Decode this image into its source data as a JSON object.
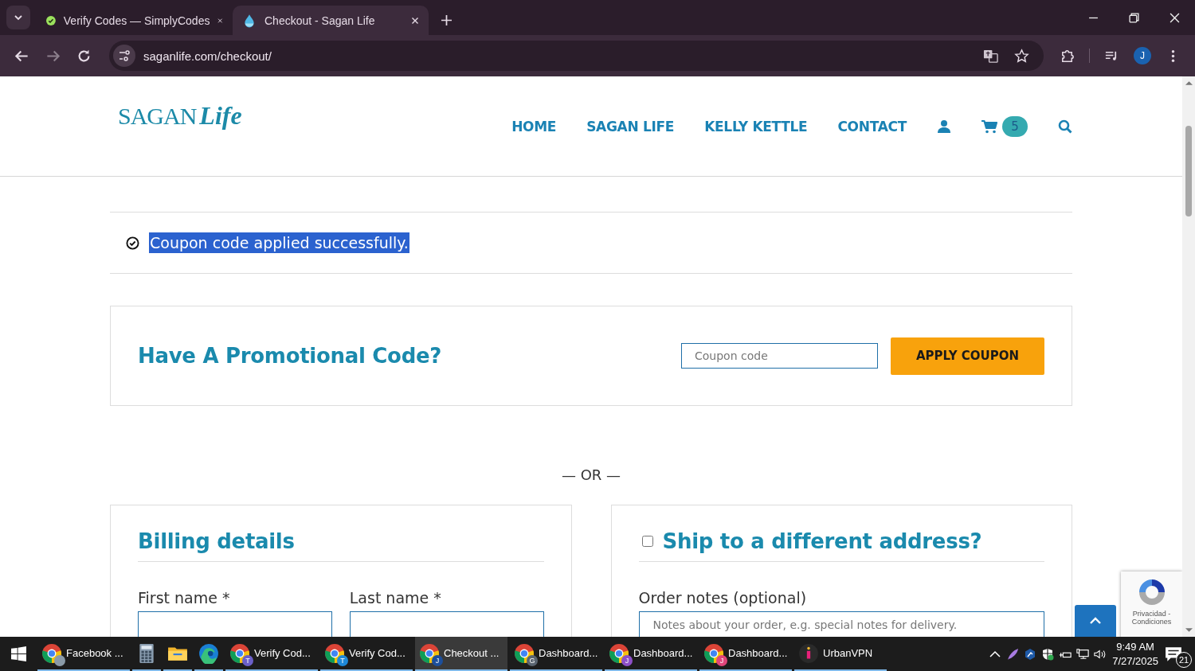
{
  "browser": {
    "tabs": [
      {
        "title": "Verify Codes — SimplyCodes",
        "kind": "simplycodes",
        "selected": false
      },
      {
        "title": "Checkout - Sagan Life",
        "kind": "drop",
        "selected": true
      }
    ],
    "url": "saganlife.com/checkout/",
    "profile_initial": "J"
  },
  "site": {
    "logo": {
      "brand": "SAGAN",
      "script": "Life"
    },
    "nav": [
      {
        "label": "HOME"
      },
      {
        "label": "SAGAN LIFE"
      },
      {
        "label": "KELLY KETTLE"
      },
      {
        "label": "CONTACT"
      }
    ],
    "cart_count": "5",
    "notice": {
      "text": "Coupon code applied successfully.",
      "selected": true
    },
    "promo": {
      "title": "Have A Promotional Code?",
      "placeholder": "Coupon code",
      "button": "APPLY COUPON"
    },
    "or_divider": "— OR —",
    "billing": {
      "title": "Billing details",
      "fields": [
        {
          "label": "First name *"
        },
        {
          "label": "Last name *"
        }
      ]
    },
    "shipping": {
      "title": "Ship to a different address?",
      "checked": false
    },
    "order_notes": {
      "label": "Order notes (optional)",
      "placeholder": "Notes about your order, e.g. special notes for delivery."
    },
    "recaptcha": {
      "links": "Privacidad - Condiciones"
    }
  },
  "taskbar": {
    "items": [
      {
        "kind": "chrome",
        "label": "Facebook ...",
        "color": "#8a9aa8",
        "selected": false
      },
      {
        "kind": "calculator",
        "selected": false
      },
      {
        "kind": "explorer",
        "selected": false
      },
      {
        "kind": "edge",
        "selected": false
      },
      {
        "kind": "chrome",
        "label": "Verify Cod...",
        "badge": "T",
        "color": "#6b5fc8",
        "selected": false
      },
      {
        "kind": "chrome",
        "label": "Verify Cod...",
        "badge": "T",
        "color": "#1e88d8",
        "selected": false
      },
      {
        "kind": "chrome",
        "label": "Checkout ...",
        "badge": "J",
        "color": "#1c4f9c",
        "selected": true
      },
      {
        "kind": "chrome",
        "label": "Dashboard...",
        "badge": "G",
        "color": "#5a6470",
        "selected": false
      },
      {
        "kind": "chrome",
        "label": "Dashboard...",
        "badge": "J",
        "color": "#8d4fc8",
        "selected": false
      },
      {
        "kind": "chrome",
        "label": "Dashboard...",
        "badge": "J",
        "color": "#e0457b",
        "selected": false
      },
      {
        "kind": "vpn",
        "label": "UrbanVPN",
        "selected": false
      }
    ],
    "time": "9:49 AM",
    "date": "7/27/2025",
    "notifications": "21"
  }
}
